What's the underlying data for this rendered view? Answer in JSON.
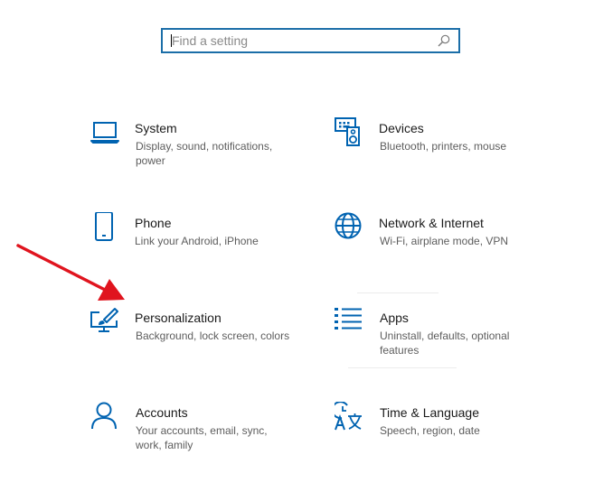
{
  "search": {
    "placeholder": "Find a setting",
    "value": ""
  },
  "tiles": [
    {
      "title": "System",
      "desc": "Display, sound, notifications, power",
      "icon": "laptop-icon"
    },
    {
      "title": "Devices",
      "desc": "Bluetooth, printers, mouse",
      "icon": "keyboard-speaker-icon"
    },
    {
      "title": "Phone",
      "desc": "Link your Android, iPhone",
      "icon": "phone-icon"
    },
    {
      "title": "Network & Internet",
      "desc": "Wi-Fi, airplane mode, VPN",
      "icon": "globe-icon"
    },
    {
      "title": "Personalization",
      "desc": "Background, lock screen, colors",
      "icon": "monitor-brush-icon"
    },
    {
      "title": "Apps",
      "desc": "Uninstall, defaults, optional features",
      "icon": "list-icon"
    },
    {
      "title": "Accounts",
      "desc": "Your accounts, email, sync, work, family",
      "icon": "person-icon"
    },
    {
      "title": "Time & Language",
      "desc": "Speech, region, date",
      "icon": "clock-language-icon"
    }
  ],
  "colors": {
    "accent": "#0063b1",
    "search_border": "#1b6ea8",
    "annotation_arrow": "#e0141e"
  }
}
